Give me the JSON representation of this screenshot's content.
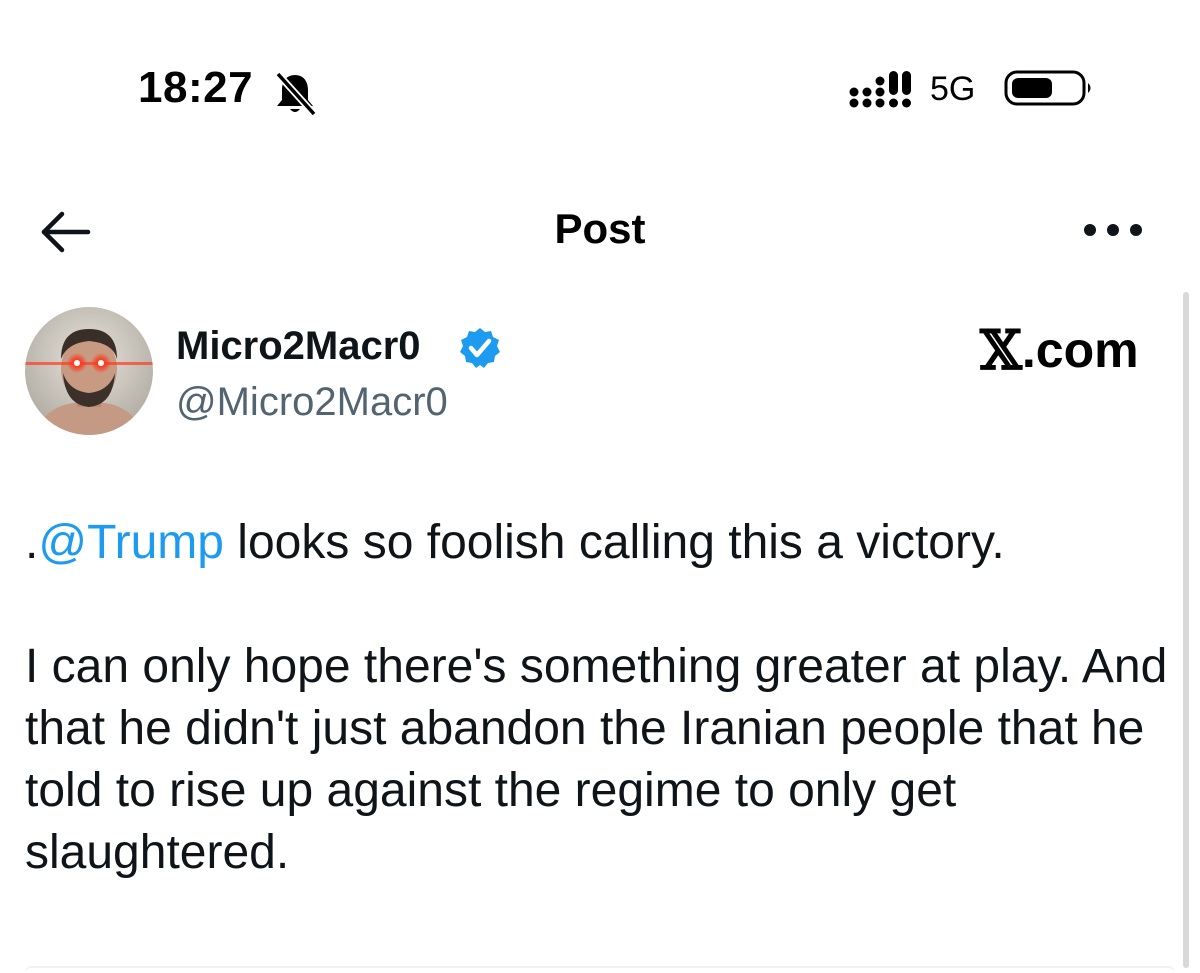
{
  "status_bar": {
    "time": "18:27",
    "network": "5G",
    "icons": [
      "bell-slash-icon",
      "signal-icon",
      "battery-icon"
    ]
  },
  "nav": {
    "title": "Post",
    "back_icon": "arrow-left-icon",
    "more_icon": "more-horizontal-icon"
  },
  "author": {
    "display_name": "Micro2Macr0",
    "handle": "@Micro2Macr0",
    "verified": true,
    "avatar_icon": "avatar-laser-eyes"
  },
  "watermark": {
    "logo": "𝕏",
    "domain": ".com"
  },
  "post": {
    "para1": {
      "prefix": ".",
      "mention": "@Trump",
      "text": " looks so foolish calling this a victory."
    },
    "para2": "I can only hope there's something greater at play. And that he didn't just abandon the Iranian people that he told to rise up against the regime to only get slaughtered."
  },
  "colors": {
    "accent": "#1d9bf0",
    "text": "#0f1419",
    "secondary": "#536471"
  }
}
